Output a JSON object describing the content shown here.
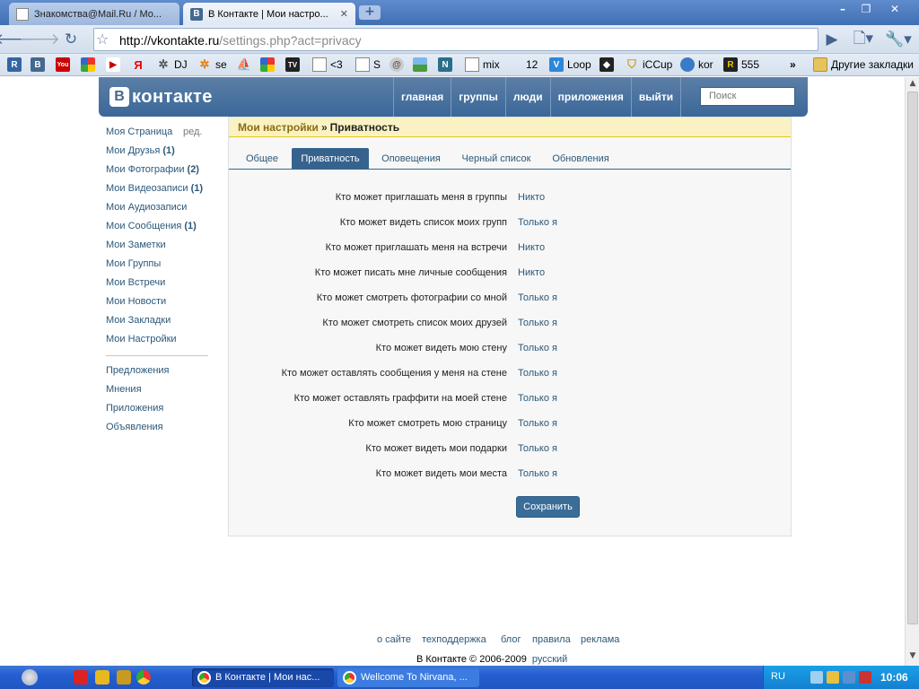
{
  "browser": {
    "tabs": [
      {
        "title": "Знакомства@Mail.Ru / Мо...",
        "active": false
      },
      {
        "title": "В Контакте | Мои настро...",
        "active": true
      }
    ],
    "url_host": "http://vkontakte.ru",
    "url_path": "/settings.php?act=privacy",
    "bookmarks": [
      "DJ",
      "se",
      "<3",
      "S",
      "mix",
      "12",
      "Loop",
      "iCCup",
      "kor",
      "555"
    ],
    "other_bookmarks": "Другие закладки",
    "bookmarks_overflow": "»"
  },
  "vk": {
    "logo_letter": "В",
    "logo_word": "контакте",
    "nav": [
      "главная",
      "группы",
      "люди",
      "приложения",
      "выйти"
    ],
    "search_placeholder": "Поиск",
    "left_menu": {
      "edit_label": "ред.",
      "items": [
        {
          "label": "Моя Страница",
          "count": ""
        },
        {
          "label": "Мои Друзья",
          "count": "(1)"
        },
        {
          "label": "Мои Фотографии",
          "count": "(2)"
        },
        {
          "label": "Мои Видеозаписи",
          "count": "(1)"
        },
        {
          "label": "Мои Аудиозаписи",
          "count": ""
        },
        {
          "label": "Мои Сообщения",
          "count": "(1)"
        },
        {
          "label": "Мои Заметки",
          "count": ""
        },
        {
          "label": "Мои Группы",
          "count": ""
        },
        {
          "label": "Мои Встречи",
          "count": ""
        },
        {
          "label": "Мои Новости",
          "count": ""
        },
        {
          "label": "Мои Закладки",
          "count": ""
        },
        {
          "label": "Мои Настройки",
          "count": ""
        }
      ],
      "extra": [
        "Предложения",
        "Мнения",
        "Приложения",
        "Объявления"
      ]
    },
    "breadcrumb": {
      "parent": "Мои настройки",
      "sep": "»",
      "current": "Приватность"
    },
    "settings_tabs": [
      {
        "label": "Общее",
        "active": false
      },
      {
        "label": "Приватность",
        "active": true
      },
      {
        "label": "Оповещения",
        "active": false
      },
      {
        "label": "Черный список",
        "active": false
      },
      {
        "label": "Обновления",
        "active": false
      }
    ],
    "privacy": [
      {
        "label": "Кто может приглашать меня в группы",
        "value": "Никто"
      },
      {
        "label": "Кто может видеть список моих групп",
        "value": "Только я"
      },
      {
        "label": "Кто может приглашать меня на встречи",
        "value": "Никто"
      },
      {
        "label": "Кто может писать мне личные сообщения",
        "value": "Никто"
      },
      {
        "label": "Кто может смотреть фотографии со мной",
        "value": "Только я"
      },
      {
        "label": "Кто может смотреть список моих друзей",
        "value": "Только я"
      },
      {
        "label": "Кто может видеть мою стену",
        "value": "Только я"
      },
      {
        "label": "Кто может оставлять сообщения у меня на стене",
        "value": "Только я"
      },
      {
        "label": "Кто может оставлять граффити на моей стене",
        "value": "Только я"
      },
      {
        "label": "Кто может смотреть мою страницу",
        "value": "Только я"
      },
      {
        "label": "Кто может видеть мои подарки",
        "value": "Только я"
      },
      {
        "label": "Кто может видеть мои места",
        "value": "Только я"
      }
    ],
    "save_label": "Сохранить",
    "footer_links": [
      "о сайте",
      "техподдержка",
      "блог",
      "правила",
      "реклама"
    ],
    "copyright": "В Контакте © 2006-2009",
    "language": "русский"
  },
  "taskbar": {
    "tasks": [
      {
        "title": "В Контакте | Мои нас...",
        "active": true
      },
      {
        "title": "Wellcome To Nirvana, ...",
        "active": false
      }
    ],
    "lang": "RU",
    "clock": "10:06"
  }
}
